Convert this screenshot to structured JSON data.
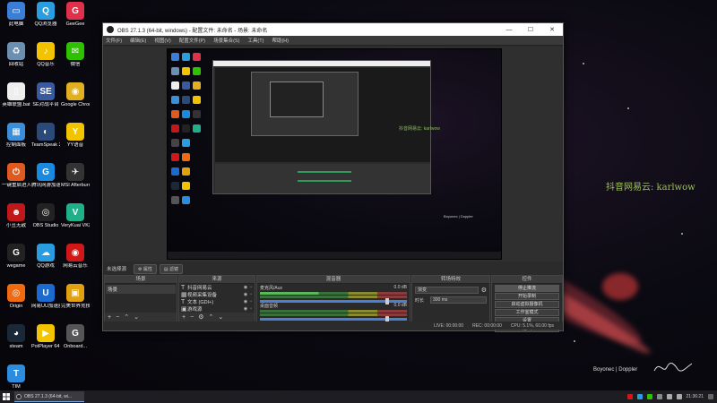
{
  "desktop": {
    "icons": [
      {
        "label": "此电脑",
        "color": "#3b7ed8",
        "glyph": "▭",
        "icon": "computer-icon"
      },
      {
        "label": "QQ浏览器",
        "color": "#2a9de0",
        "glyph": "Q",
        "icon": "qq-browser-icon"
      },
      {
        "label": "GeeGee",
        "color": "#e0304a",
        "glyph": "G",
        "icon": "geegee-icon"
      },
      {
        "label": "回收站",
        "color": "#6a8fb0",
        "glyph": "♻",
        "icon": "recycle-bin-icon"
      },
      {
        "label": "QQ音乐",
        "color": "#f2c400",
        "glyph": "♪",
        "icon": "qq-music-icon"
      },
      {
        "label": "微信",
        "color": "#2dc100",
        "glyph": "✉",
        "icon": "wechat-icon"
      },
      {
        "label": "英雄联盟.bat",
        "color": "#eee",
        "glyph": "▯",
        "icon": "file-icon"
      },
      {
        "label": "SE对战平台",
        "color": "#3a5aa0",
        "glyph": "SE",
        "icon": "se-platform-icon"
      },
      {
        "label": "Google Chrome",
        "color": "#e0b020",
        "glyph": "◉",
        "icon": "chrome-icon"
      },
      {
        "label": "控制面板",
        "color": "#3b8ed8",
        "glyph": "▦",
        "icon": "control-panel-icon"
      },
      {
        "label": "TeamSpeak 3",
        "color": "#2a4a7a",
        "glyph": "◐",
        "icon": "teamspeak-icon"
      },
      {
        "label": "YY语音",
        "color": "#f2c400",
        "glyph": "Y",
        "icon": "yy-icon"
      },
      {
        "label": "一键重启进入BIOS",
        "color": "#e05a20",
        "glyph": "⏻",
        "icon": "bios-icon"
      },
      {
        "label": "腾讯网游加速器",
        "color": "#1a8ae0",
        "glyph": "G",
        "icon": "tencent-accelerator-icon"
      },
      {
        "label": "MSI Afterburner",
        "color": "#333",
        "glyph": "✈",
        "icon": "afterburner-icon"
      },
      {
        "label": "小丑无敌",
        "color": "#c01818",
        "glyph": "☻",
        "icon": "app-icon"
      },
      {
        "label": "OBS Studio",
        "color": "#222",
        "glyph": "◎",
        "icon": "obs-icon"
      },
      {
        "label": "VeryKuai VK加速器",
        "color": "#1fb08a",
        "glyph": "V",
        "icon": "vk-icon"
      },
      {
        "label": "wegame",
        "color": "#222",
        "glyph": "G",
        "icon": "wegame-icon"
      },
      {
        "label": "QQ游戏",
        "color": "#2a9de0",
        "glyph": "☁",
        "icon": "qq-game-icon"
      },
      {
        "label": "网易云音乐",
        "color": "#d01818",
        "glyph": "◉",
        "icon": "netease-music-icon"
      },
      {
        "label": "Origin",
        "color": "#f06a10",
        "glyph": "◎",
        "icon": "origin-icon"
      },
      {
        "label": "网易UU加速器",
        "color": "#1a6ad0",
        "glyph": "U",
        "icon": "uu-icon"
      },
      {
        "label": "完美世界竞技平台",
        "color": "#e0a010",
        "glyph": "▣",
        "icon": "perfect-world-icon"
      },
      {
        "label": "steam",
        "color": "#1b2838",
        "glyph": "◕",
        "icon": "steam-icon"
      },
      {
        "label": "PotPlayer 64 bit",
        "color": "#f2c400",
        "glyph": "▶",
        "icon": "potplayer-icon"
      },
      {
        "label": "Onboard...",
        "color": "#555",
        "glyph": "G",
        "icon": "onboard-icon"
      },
      {
        "label": "TIM",
        "color": "#2a8de0",
        "glyph": "T",
        "icon": "tim-icon"
      }
    ]
  },
  "obs": {
    "title": "OBS 27.1.3 (64-bit, windows) - 配置文件: 未命名 - 场景: 未命名",
    "menu": [
      "文件(F)",
      "编辑(E)",
      "视图(V)",
      "配置文件(P)",
      "场景集合(S)",
      "工具(T)",
      "帮助(H)"
    ],
    "current_scene": "未选择源",
    "toolbar_buttons": [
      "⚙ 属性",
      "▤ 滤镜"
    ],
    "docks": {
      "scenes": {
        "title": "场景",
        "items": [
          "场景"
        ]
      },
      "sources": {
        "title": "来源",
        "items": [
          {
            "glyph": "T",
            "label": "抖音网易云"
          },
          {
            "glyph": "▦",
            "label": "视频采集设备"
          },
          {
            "glyph": "T",
            "label": "文本 (GDI+)"
          },
          {
            "glyph": "▣",
            "label": "游戏源"
          },
          {
            "glyph": "▭",
            "label": "显示器采集"
          }
        ]
      },
      "mixer": {
        "title": "混音器",
        "channels": [
          {
            "name": "麦克风/Aux",
            "db": "0.0 dB"
          },
          {
            "name": "桌面音频",
            "db": "0.0 dB"
          }
        ]
      },
      "transitions": {
        "title": "转场特效",
        "type": "渐变",
        "duration_label": "时长",
        "duration": "300 ms"
      },
      "controls": {
        "title": "控件",
        "buttons": [
          "停止推流",
          "开始录制",
          "启动虚拟摄像机",
          "工作室模式",
          "设置",
          "退出"
        ]
      }
    },
    "status": {
      "live": "LIVE: 00:00:00",
      "rec": "REC: 00:00:00",
      "cpu": "CPU: 5.1%, 60.00 fps"
    }
  },
  "overlay": {
    "watermark": "抖音网易云: karlwow",
    "brand": "Boyonec | Doppler"
  },
  "taskbar": {
    "app": "OBS 27.1.3 (64-bit, wi...",
    "time": "21:36:21"
  }
}
